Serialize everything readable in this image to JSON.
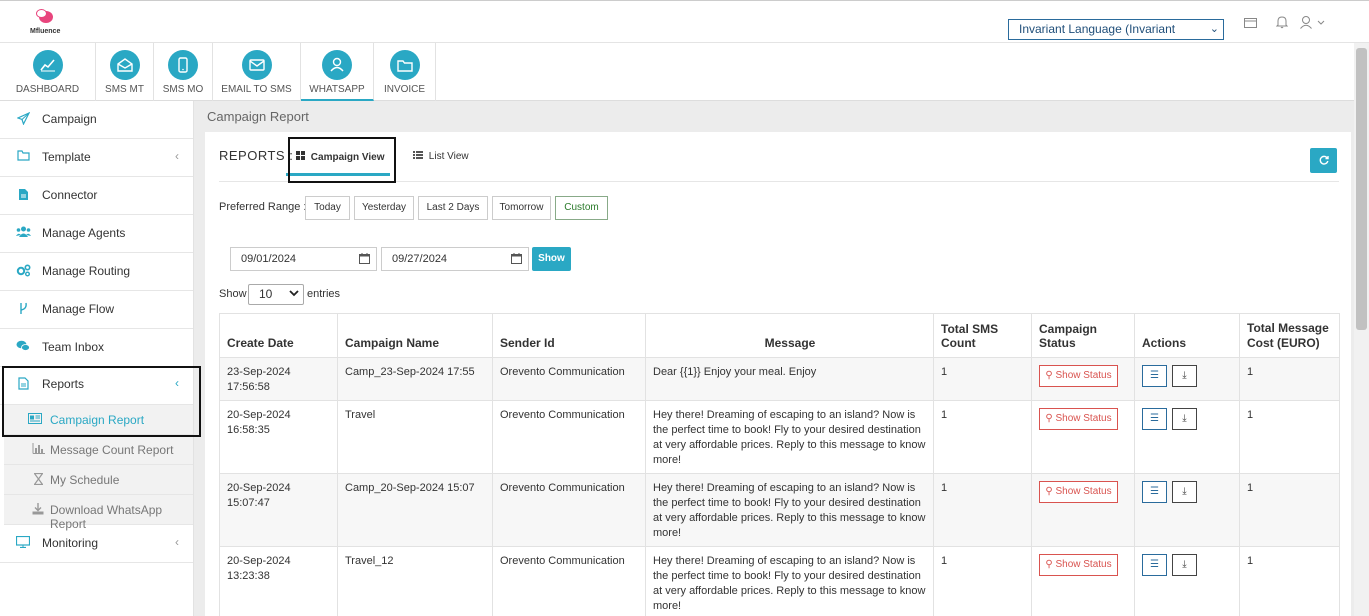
{
  "header": {
    "logo_text": "Mfluence",
    "language": "Invariant Language (Invariant Country)"
  },
  "modules": [
    {
      "label": "DASHBOARD",
      "icon": "chart-line-icon"
    },
    {
      "label": "SMS MT",
      "icon": "envelope-open-icon"
    },
    {
      "label": "SMS MO",
      "icon": "mobile-icon"
    },
    {
      "label": "EMAIL TO SMS",
      "icon": "envelope-icon"
    },
    {
      "label": "WHATSAPP",
      "icon": "user-icon"
    },
    {
      "label": "INVOICE",
      "icon": "folder-icon"
    }
  ],
  "sidebar": {
    "items": [
      {
        "label": "Campaign"
      },
      {
        "label": "Template"
      },
      {
        "label": "Connector"
      },
      {
        "label": "Manage Agents"
      },
      {
        "label": "Manage Routing"
      },
      {
        "label": "Manage Flow"
      },
      {
        "label": "Team Inbox"
      },
      {
        "label": "Reports"
      },
      {
        "label": "Monitoring"
      }
    ],
    "sub_items": [
      {
        "label": "Campaign Report"
      },
      {
        "label": "Message Count Report"
      },
      {
        "label": "My Schedule"
      },
      {
        "label": "Download WhatsApp Report"
      }
    ]
  },
  "page": {
    "title": "Campaign Report",
    "reports_label": "REPORTS :",
    "campaign_view": "Campaign View",
    "list_view": "List View",
    "preferred_range": "Preferred Range :",
    "ranges": [
      "Today",
      "Yesterday",
      "Last 2 Days",
      "Tomorrow",
      "Custom"
    ],
    "date_from": "09/01/2024",
    "date_to": "09/27/2024",
    "show_button": "Show",
    "show_label": "Show",
    "entries_value": "10",
    "entries_label": "entries"
  },
  "table": {
    "headers": [
      "Create Date",
      "Campaign Name",
      "Sender Id",
      "Message",
      "Total SMS Count",
      "Campaign Status",
      "Actions",
      "Total Message Cost (EURO)"
    ],
    "status_button": "Show Status",
    "rows": [
      {
        "date": "23-Sep-2024 17:56:58",
        "name": "Camp_23-Sep-2024 17:55",
        "sender": "Orevento Communication",
        "message": "Dear {{1}} Enjoy your meal. Enjoy",
        "count": "1",
        "cost": "1"
      },
      {
        "date": "20-Sep-2024 16:58:35",
        "name": "Travel",
        "sender": "Orevento Communication",
        "message": "Hey there! Dreaming of escaping to an island? Now is the perfect time to book! Fly to your desired destination at very affordable prices. Reply to this message to know more!",
        "count": "1",
        "cost": "1"
      },
      {
        "date": "20-Sep-2024 15:07:47",
        "name": "Camp_20-Sep-2024 15:07",
        "sender": "Orevento Communication",
        "message": "Hey there! Dreaming of escaping to an island? Now is the perfect time to book! Fly to your desired destination at very affordable prices. Reply to this message to know more!",
        "count": "1",
        "cost": "1"
      },
      {
        "date": "20-Sep-2024 13:23:38",
        "name": "Travel_12",
        "sender": "Orevento Communication",
        "message": "Hey there! Dreaming of escaping to an island? Now is the perfect time to book! Fly to your desired destination at very affordable prices. Reply to this message to know more!",
        "count": "1",
        "cost": "1"
      }
    ]
  },
  "colors": {
    "accent": "#2aa8c4",
    "danger": "#d9534f",
    "custom_green": "#2a7a2a"
  }
}
